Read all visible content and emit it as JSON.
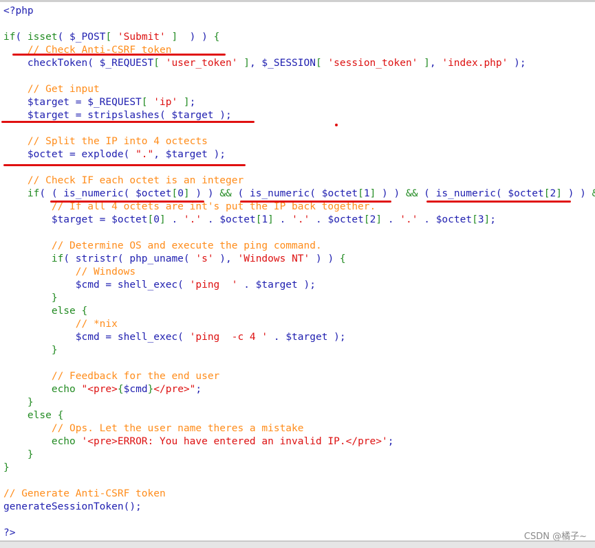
{
  "colors": {
    "comment": "#ff8c1a",
    "string": "#dd1111",
    "keyword": "#228b22",
    "identifier": "#2020b0",
    "annotation": "#e01010"
  },
  "code_lines": [
    "<?php",
    "",
    "if( isset( $_POST[ 'Submit' ]  ) ) {",
    "    // Check Anti-CSRF token",
    "    checkToken( $_REQUEST[ 'user_token' ], $_SESSION[ 'session_token' ], 'index.php' );",
    "",
    "    // Get input",
    "    $target = $_REQUEST[ 'ip' ];",
    "    $target = stripslashes( $target );",
    "",
    "    // Split the IP into 4 octects",
    "    $octet = explode( \".\", $target );",
    "",
    "    // Check IF each octet is an integer",
    "    if( ( is_numeric( $octet[0] ) ) && ( is_numeric( $octet[1] ) ) && ( is_numeric( $octet[2] ) ) &",
    "        // If all 4 octets are int's put the IP back together.",
    "        $target = $octet[0] . '.' . $octet[1] . '.' . $octet[2] . '.' . $octet[3];",
    "",
    "        // Determine OS and execute the ping command.",
    "        if( stristr( php_uname( 's' ), 'Windows NT' ) ) {",
    "            // Windows",
    "            $cmd = shell_exec( 'ping  ' . $target );",
    "        }",
    "        else {",
    "            // *nix",
    "            $cmd = shell_exec( 'ping  -c 4 ' . $target );",
    "        }",
    "",
    "        // Feedback for the end user",
    "        echo \"<pre>{$cmd}</pre>\";",
    "    }",
    "    else {",
    "        // Ops. Let the user name theres a mistake",
    "        echo '<pre>ERROR: You have entered an invalid IP.</pre>';",
    "    }",
    "}",
    "",
    "// Generate Anti-CSRF token",
    "generateSessionToken();",
    "",
    "?>"
  ],
  "watermark": "CSDN @橘子~"
}
